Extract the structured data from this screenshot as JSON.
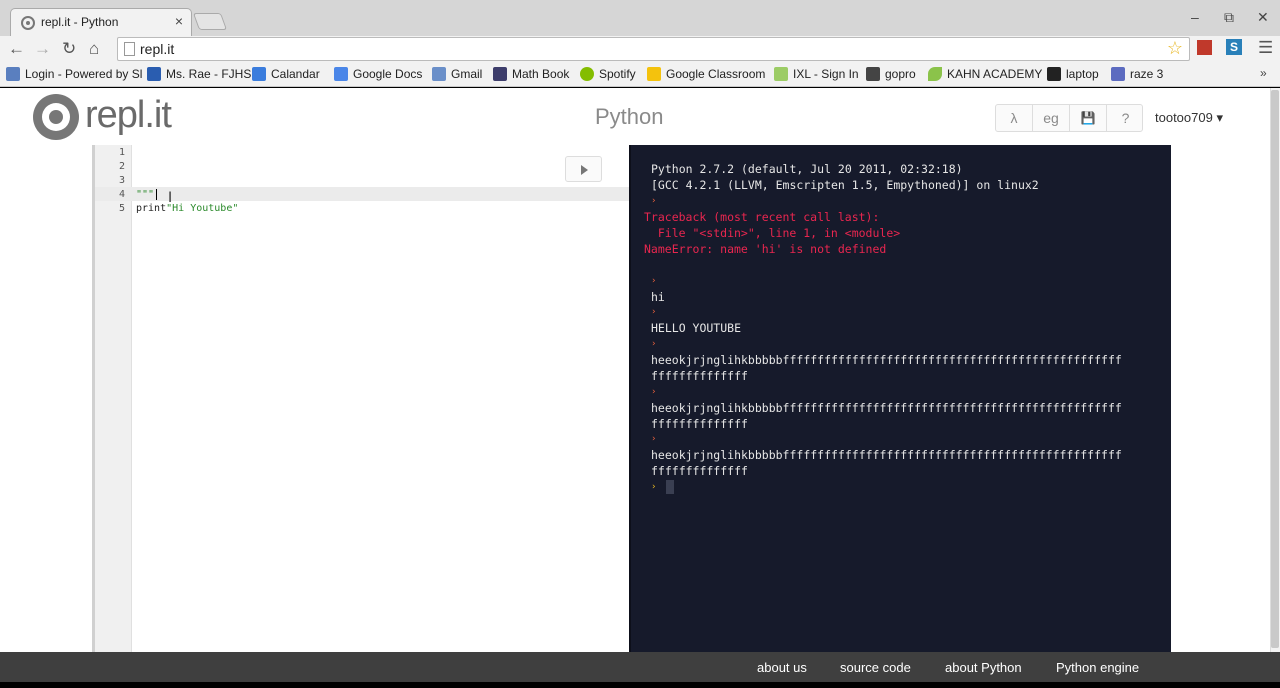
{
  "browser": {
    "tab_title": "repl.it - Python",
    "tab_close": "×",
    "window_controls": [
      "–",
      "⧉",
      "✕"
    ],
    "nav": {
      "back": "←",
      "forward": "→",
      "reload": "↻",
      "home": "⌂"
    },
    "url": "repl.it",
    "star_icon": "☆",
    "ext_s_label": "S",
    "menu_icon": "☰",
    "bookmarks": [
      {
        "label": "Login - Powered by Sl",
        "icon_color": "#5a7fbf"
      },
      {
        "label": "Ms. Rae - FJHS",
        "icon_color": "#2a5db0"
      },
      {
        "label": "Calandar",
        "icon_color": "#3b7ddd"
      },
      {
        "label": "Google Docs",
        "icon_color": "#4a86e8"
      },
      {
        "label": "Gmail",
        "icon_color": "#6a8fc9"
      },
      {
        "label": "Math Book",
        "icon_color": "#3d3d6b"
      },
      {
        "label": "Spotify",
        "icon_color": "#84bd00"
      },
      {
        "label": "Google Classroom",
        "icon_color": "#f4c20d"
      },
      {
        "label": "IXL - Sign In",
        "icon_color": "#9ccc65"
      },
      {
        "label": "gopro",
        "icon_color": "#444444"
      },
      {
        "label": "KAHN ACADEMY",
        "icon_color": "#8bc34a"
      },
      {
        "label": "laptop",
        "icon_color": "#222222"
      },
      {
        "label": "raze 3",
        "icon_color": "#5c6bc0"
      }
    ],
    "bookmarks_more": "»"
  },
  "app": {
    "logo_text": "repl.it",
    "language_title": "Python",
    "tools": [
      "λ",
      "eg",
      "💾",
      "?"
    ],
    "user_menu": "tootoo709 ▾",
    "run_icon": "play-icon"
  },
  "editor": {
    "line_numbers": [
      "1",
      "2",
      "3",
      "4",
      "5"
    ],
    "lines": {
      "l4": "\"\"\"",
      "l5_keyword": "print",
      "l5_string": "\"Hi Youtube\""
    },
    "ibeam": "I"
  },
  "console": {
    "header_1": "Python 2.7.2 (default, Jul 20 2011, 02:32:18)",
    "header_2": "[GCC 4.2.1 (LLVM, Emscripten 1.5, Empythoned)] on linux2",
    "traceback_1": "Traceback (most recent call last):",
    "traceback_2": "  File \"<stdin>\", line 1, in <module>",
    "traceback_3": "NameError: name 'hi' is not defined",
    "out_hi": "hi",
    "out_hello": "HELLO YOUTUBE",
    "out_long_a": "heeokjrjnglihkbbbbbfffffffffffffffffffffffffffffffffffffffffffffffff",
    "out_long_b": "ffffffffffffff",
    "prompt_char": "›"
  },
  "footer": {
    "links": [
      "about us",
      "source code",
      "about Python",
      "Python engine"
    ]
  }
}
